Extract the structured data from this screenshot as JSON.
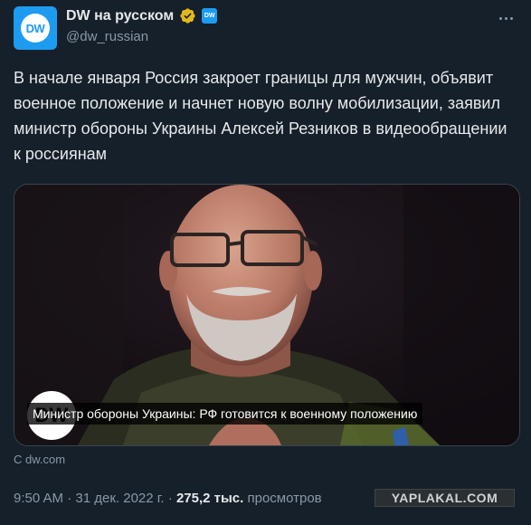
{
  "author": {
    "display_name": "DW на русском",
    "handle": "@dw_russian",
    "avatar_text": "DW",
    "affiliation_badge": "DW"
  },
  "tweet": {
    "text": "В начале января Россия закроет границы для мужчин, объявит военное положение и начнет новую волну мобилизации, заявил министр обороны Украины Алексей Резников в видеообращении к россиянам"
  },
  "media": {
    "logo_text": "DW",
    "caption": "Министр обороны Украины: РФ готовится к военному положению",
    "source": "С dw.com"
  },
  "meta": {
    "time": "9:50 AM",
    "separator": "·",
    "date": "31 дек. 2022 г.",
    "views_count": "275,2 тыс.",
    "views_label": "просмотров"
  },
  "watermark": "YAPLAKAL.COM",
  "colors": {
    "background": "#15202b",
    "accent": "#1d9bf0",
    "verified": "#e2b719",
    "muted_text": "#8b98a5"
  }
}
